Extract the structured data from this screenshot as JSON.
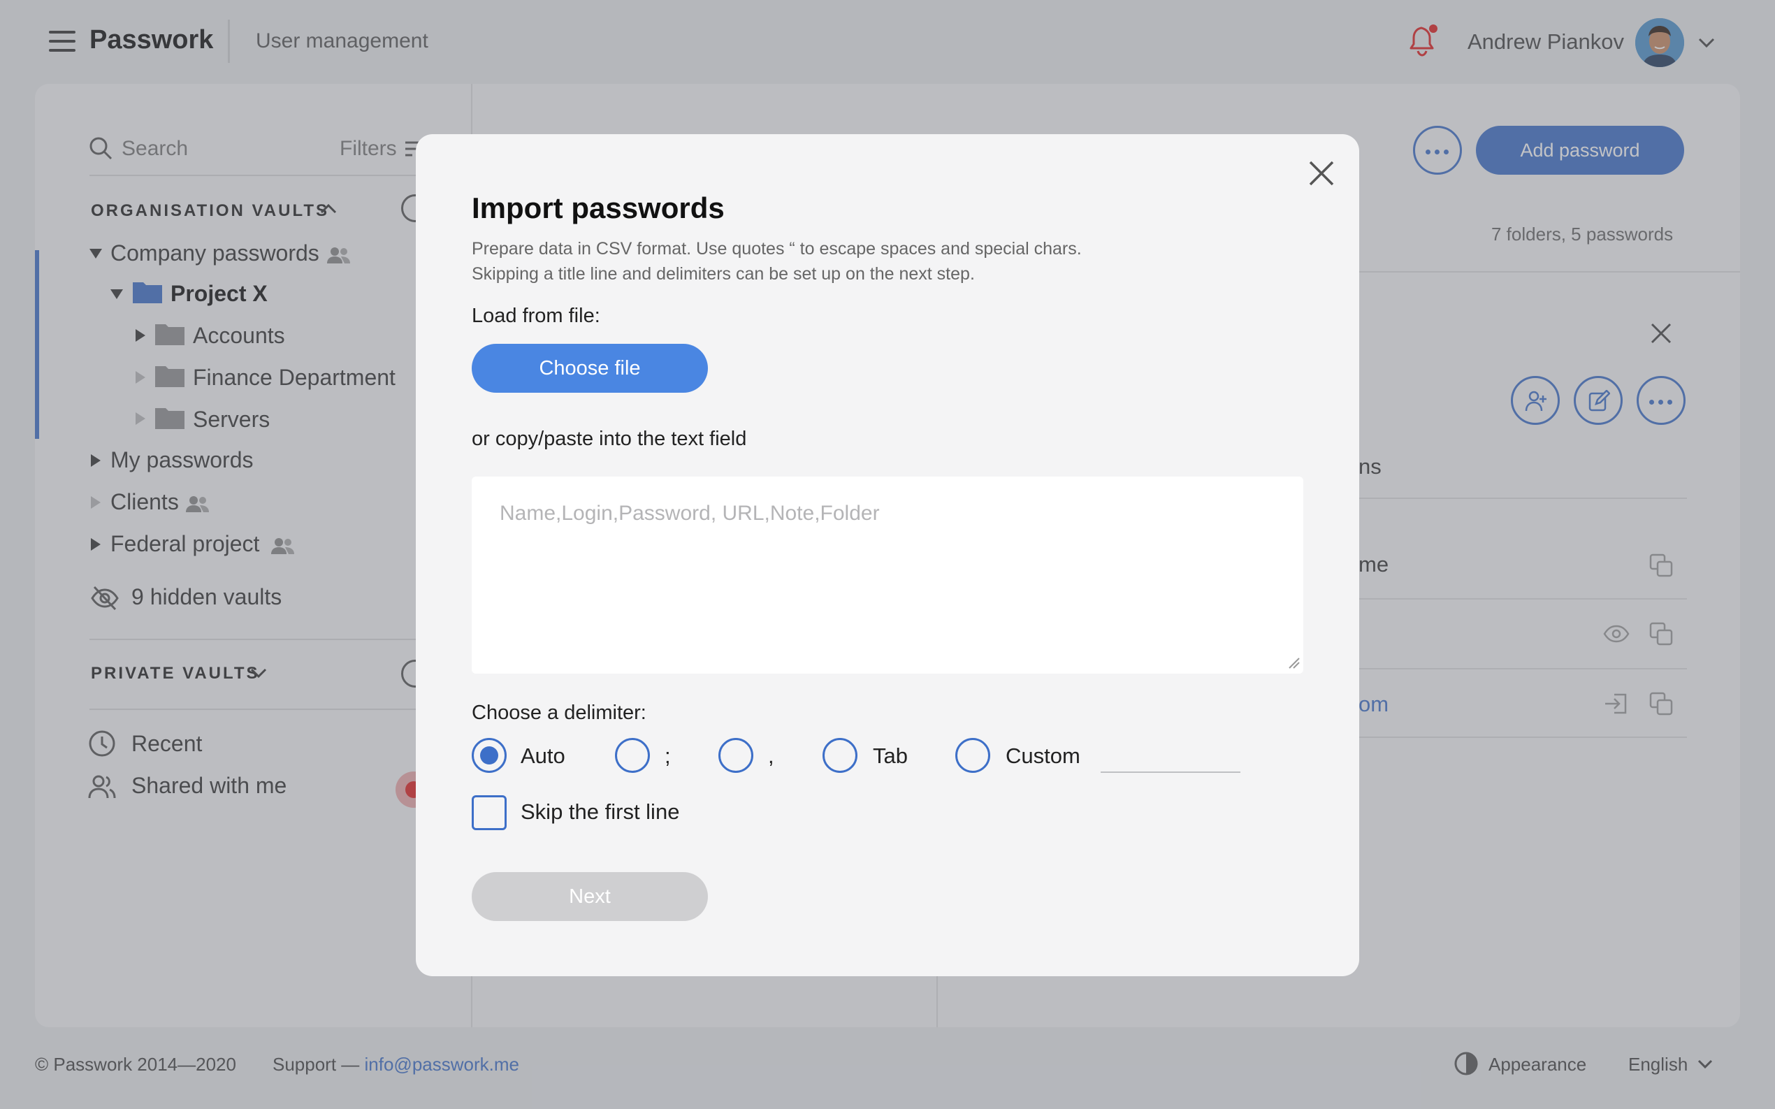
{
  "header": {
    "brand": "Passwork",
    "section_title": "User management",
    "user_name": "Andrew Piankov"
  },
  "sidebar": {
    "search_label": "Search",
    "filters_label": "Filters",
    "org_vaults_title": "ORGANISATION VAULTS",
    "tree": {
      "company_passwords": "Company passwords",
      "project_x": "Project X",
      "accounts": "Accounts",
      "finance_department": "Finance Department",
      "servers": "Servers",
      "my_passwords": "My passwords",
      "clients": "Clients",
      "federal_project": "Federal project"
    },
    "hidden_vaults": "9 hidden vaults",
    "private_vaults_title": "PRIVATE VAULTS",
    "recent": "Recent",
    "shared_with_me": "Shared with me"
  },
  "content": {
    "add_password_label": "Add password",
    "folders_count": "7 folders, 5 passwords",
    "peek_tab_fragment": "ns",
    "peek_row1_fragment": "me",
    "peek_row3_fragment": "om"
  },
  "modal": {
    "title": "Import passwords",
    "description_line1": "Prepare data in CSV format. Use quotes “ to escape spaces and special chars.",
    "description_line2": "Skipping a title line and delimiters can be set up on the next step.",
    "load_from_file_label": "Load from file:",
    "choose_file_label": "Choose file",
    "paste_label": "or copy/paste into the text field",
    "textarea_placeholder": "Name,Login,Password, URL,Note,Folder",
    "delimiter_label": "Choose a delimiter:",
    "delimiters": [
      {
        "label": "Auto",
        "selected": true
      },
      {
        "label": ";",
        "selected": false
      },
      {
        "label": ",",
        "selected": false
      },
      {
        "label": "Tab",
        "selected": false
      },
      {
        "label": "Custom",
        "selected": false
      }
    ],
    "custom_value": "",
    "skip_first_line_label": "Skip the first line",
    "skip_first_line_checked": false,
    "next_label": "Next"
  },
  "footer": {
    "copyright": "© Passwork 2014—2020",
    "support_prefix": "Support — ",
    "support_email": "info@passwork.me",
    "appearance_label": "Appearance",
    "language": "English"
  },
  "colors": {
    "accent": "#3d6fc8",
    "choose_file_bg": "#4a86e2",
    "notification_dot": "#e02020",
    "disabled_button": "#cfcfd1"
  }
}
